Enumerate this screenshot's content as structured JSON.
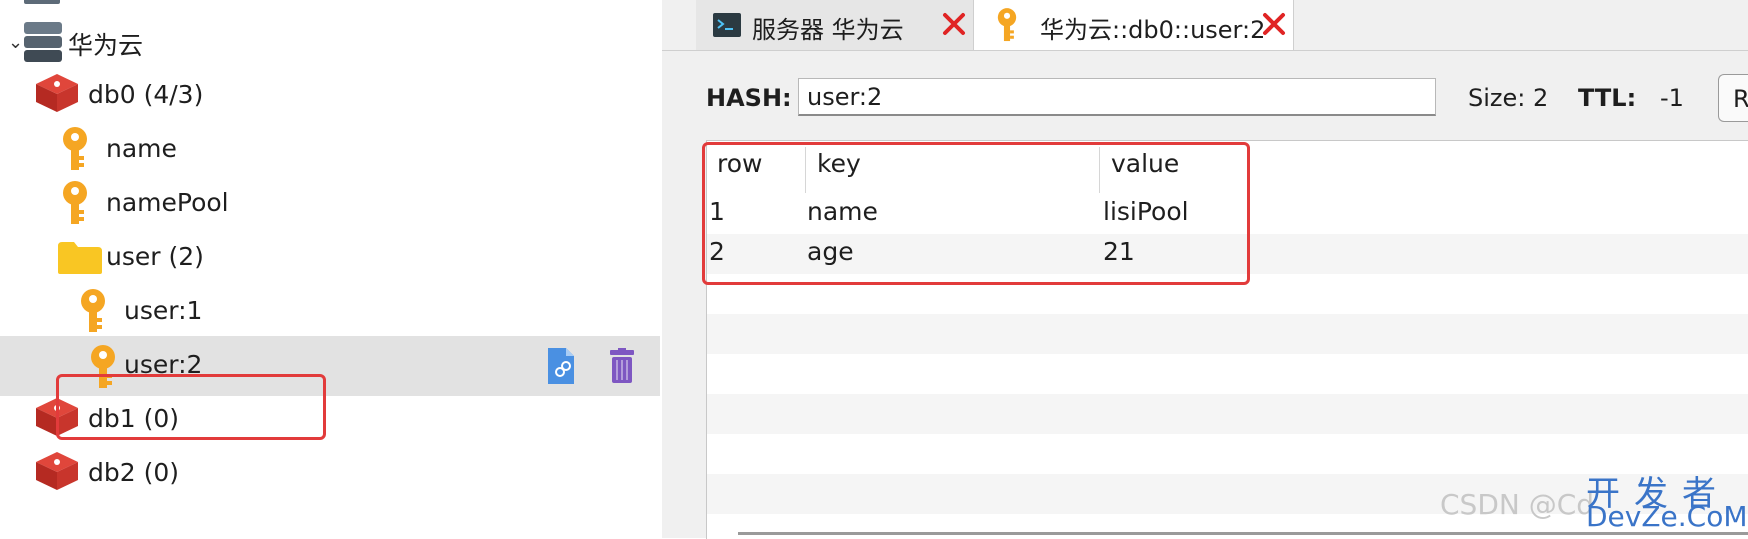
{
  "tree": {
    "server": {
      "label": "华为云"
    },
    "db0": {
      "label": "db0  (4/3)"
    },
    "keys": [
      {
        "label": "name"
      },
      {
        "label": "namePool"
      }
    ],
    "folder": {
      "label": "user (2)"
    },
    "user_keys": [
      {
        "label": "user:1"
      },
      {
        "label": "user:2"
      }
    ],
    "db1": {
      "label": "db1 (0)"
    },
    "db2": {
      "label": "db2 (0)"
    }
  },
  "tabs": [
    {
      "label": "服务器 华为云",
      "icon": "terminal-icon"
    },
    {
      "label": "华为云::db0::user:2",
      "icon": "key-icon"
    }
  ],
  "key_header": {
    "type_label": "HASH:",
    "key_value": "user:2",
    "size_text": "Size: 2",
    "ttl_label": "TTL:",
    "ttl_value": "-1",
    "button_label": "R"
  },
  "table": {
    "columns": [
      "row",
      "key",
      "value"
    ],
    "rows": [
      {
        "row": "1",
        "key": "name",
        "value": "lisiPool"
      },
      {
        "row": "2",
        "key": "age",
        "value": "21"
      }
    ]
  },
  "watermark": {
    "csdn": "CSDN @Cd",
    "line1": "开发者",
    "line2": "DevZe.CoM"
  },
  "colors": {
    "highlight": "#e23b3b",
    "key_orange": "#f5a623",
    "redis_red": "#d32f2f",
    "folder_yellow": "#f9c623"
  }
}
